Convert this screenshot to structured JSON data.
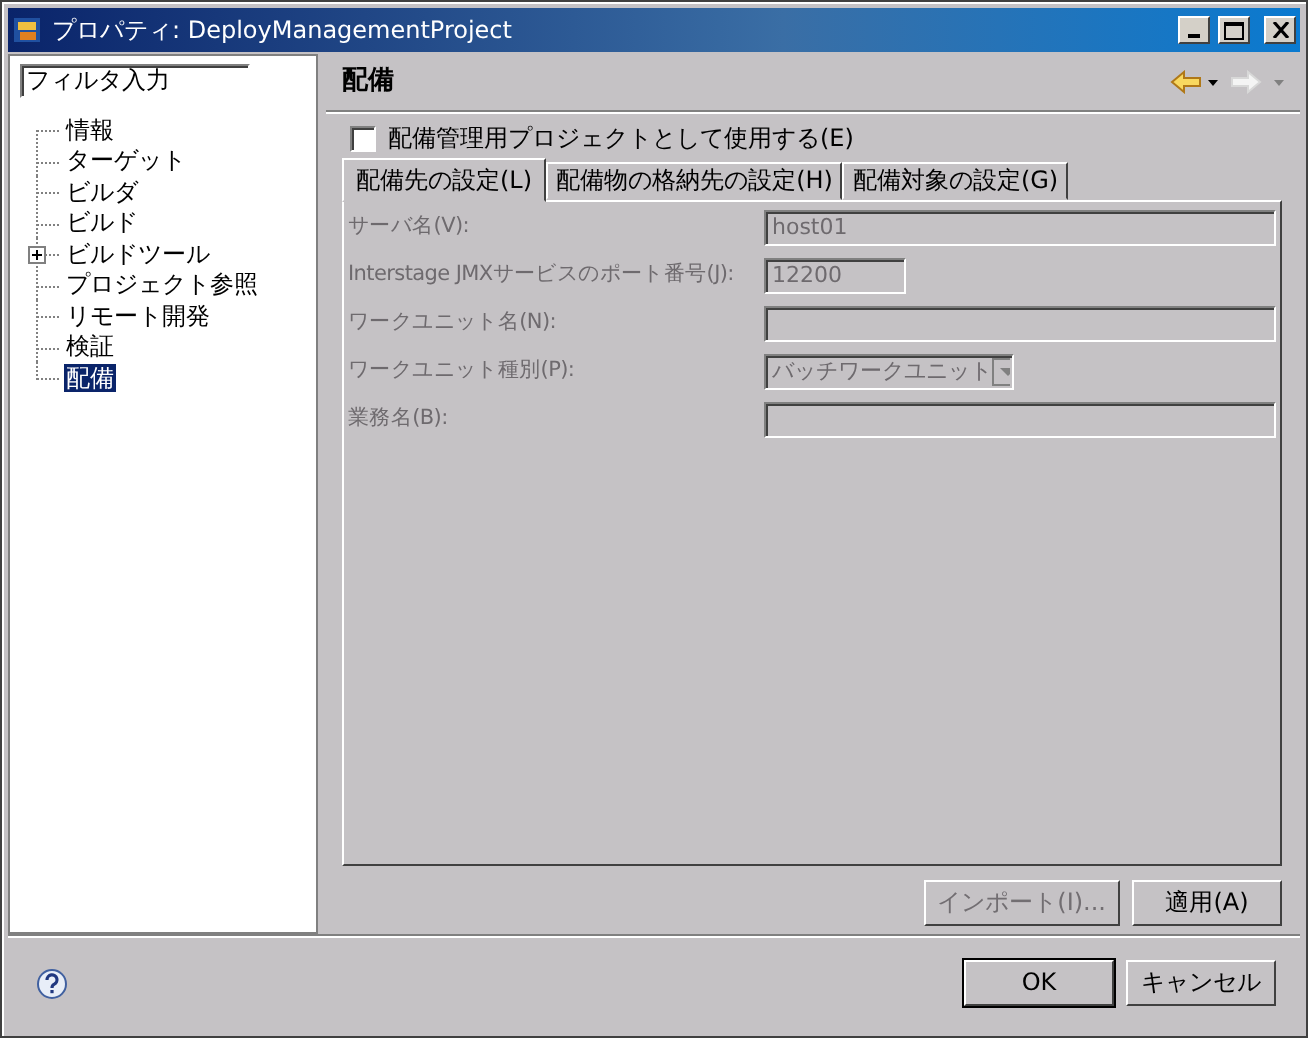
{
  "window": {
    "title": "プロパティ: DeployManagementProject"
  },
  "filter": {
    "value": "フィルタ入力"
  },
  "tree": [
    {
      "label": "情報",
      "selected": false
    },
    {
      "label": "ターゲット",
      "selected": false
    },
    {
      "label": "ビルダ",
      "selected": false
    },
    {
      "label": "ビルド",
      "selected": false
    },
    {
      "label": "ビルドツール",
      "selected": false,
      "expanded": false
    },
    {
      "label": "プロジェクト参照",
      "selected": false
    },
    {
      "label": "リモート開発",
      "selected": false
    },
    {
      "label": "検証",
      "selected": false
    },
    {
      "label": "配備",
      "selected": true
    }
  ],
  "page": {
    "title": "配備"
  },
  "use_checkbox": {
    "label": "配備管理用プロジェクトとして使用する(E)",
    "checked": false
  },
  "tabs": [
    {
      "label": "配備先の設定(L)",
      "selected": true
    },
    {
      "label": "配備物の格納先の設定(H)",
      "selected": false
    },
    {
      "label": "配備対象の設定(G)",
      "selected": false
    }
  ],
  "fields": [
    {
      "kind": "text",
      "label": "サーバ名(V):",
      "value": "host01",
      "disabled": true
    },
    {
      "kind": "text",
      "label": "Interstage JMXサービスのポート番号(J):",
      "value": "12200",
      "disabled": true
    },
    {
      "kind": "text",
      "label": "ワークユニット名(N):",
      "disabled": true
    },
    {
      "kind": "combo",
      "label": "ワークユニット種別(P):",
      "value": "バッチワークユニット",
      "disabled": true
    },
    {
      "kind": "text",
      "label": "業務名(B):",
      "disabled": true
    }
  ],
  "page_buttons": [
    {
      "label": "インポート(I)...",
      "disabled": true
    },
    {
      "label": "適用(A)",
      "disabled": false
    }
  ],
  "dialog_buttons": [
    {
      "label": "OK",
      "default": true
    },
    {
      "label": "キャンセル",
      "default": false
    }
  ]
}
